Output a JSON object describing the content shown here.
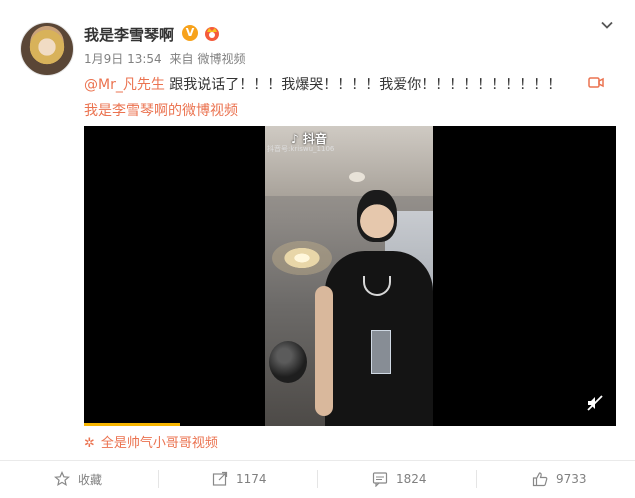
{
  "post": {
    "username": "我是李雪琴啊",
    "verified_badge": "V",
    "date": "1月9日 13:54",
    "source_prefix": "来自",
    "source": "微博视频",
    "mention": "@Mr_凡先生",
    "text": " 跟我说话了！！！我爆哭！！！！我爱你！！！！！！！！！！",
    "video_source_link": "我是李雪琴啊的微博视频"
  },
  "video": {
    "watermark_app": "抖音",
    "watermark_id": "抖音号:kriswu_1106",
    "progress": 0.18,
    "topic": "全是帅气小哥哥视频"
  },
  "actions": {
    "favorite_label": "收藏",
    "repost_count": "1174",
    "comment_count": "1824",
    "like_count": "9733"
  },
  "colors": {
    "accent": "#eb7350",
    "text": "#333333",
    "muted": "#808080",
    "progress": "#f7b500",
    "verified": "#f7a21b"
  }
}
